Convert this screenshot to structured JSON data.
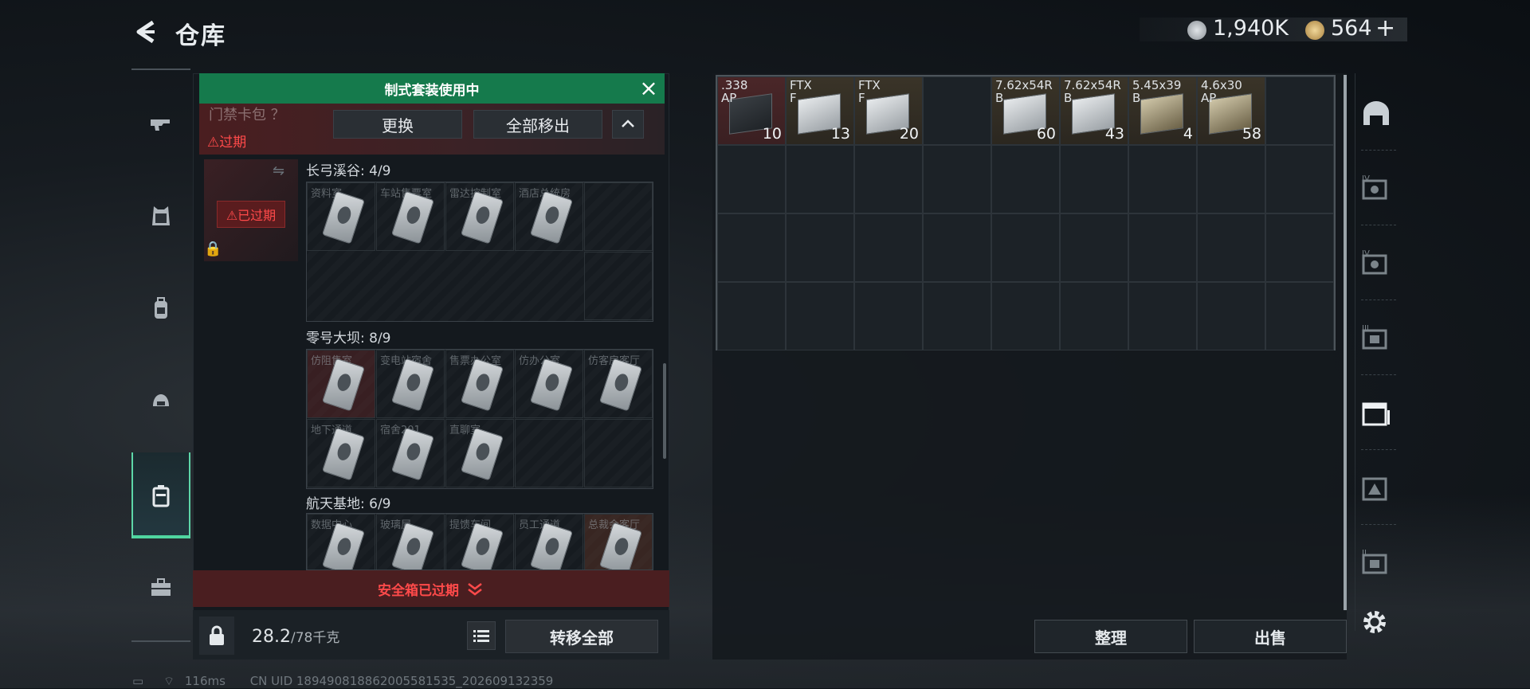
{
  "header": {
    "title": "仓库",
    "currency1": "1,940K",
    "currency2": "564",
    "add_symbol": "+"
  },
  "left_rail": {
    "items": [
      {
        "name": "rail-weapon",
        "icon": "gun-icon"
      },
      {
        "name": "rail-armor",
        "icon": "vest-icon"
      },
      {
        "name": "rail-backpack",
        "icon": "backpack-icon"
      },
      {
        "name": "rail-helmet",
        "icon": "helmet-icon"
      },
      {
        "name": "rail-keycard-case",
        "icon": "case-icon",
        "active": true
      },
      {
        "name": "rail-toolbox",
        "icon": "toolbox-icon"
      }
    ]
  },
  "left_panel": {
    "banner": "制式套装使用中",
    "package_label": "门禁卡包 ？",
    "expired_tag": "⚠过期",
    "replace_button": "更换",
    "remove_all_button": "全部移出",
    "slot_expired": "⚠已过期",
    "sections": [
      {
        "title": "长弓溪谷: 4/9",
        "cells": [
          "资料室",
          "车站售票室",
          "雷达控制室",
          "酒店总统房"
        ]
      },
      {
        "title": "零号大坝: 8/9",
        "cells": [
          "仿阻售室",
          "变电站宿舍",
          "售票办公室",
          "仿办公室",
          "仿客房客厅",
          "地下通道",
          "宿舍201",
          "直聊室"
        ]
      },
      {
        "title": "航天基地: 6/9",
        "cells": [
          "数据中心",
          "玻璃屋",
          "提馈车间",
          "员工通道",
          "总裁会客厅"
        ]
      }
    ],
    "safe_box_status": "安全箱已过期",
    "weight_current": "28.2",
    "weight_max": "/78千克",
    "transfer_all_button": "转移全部"
  },
  "stash": {
    "items": [
      {
        "label": ".338\nAP",
        "count": "10",
        "style": "red",
        "box": "dark"
      },
      {
        "label": "FTX\nF",
        "count": "13",
        "style": "tan",
        "box": "light"
      },
      {
        "label": "FTX\nF",
        "count": "20",
        "style": "tan",
        "box": "light"
      },
      {
        "label": "",
        "count": "",
        "style": "empty",
        "box": "none"
      },
      {
        "label": "7.62x54R\nB",
        "count": "60",
        "style": "tan",
        "box": "light"
      },
      {
        "label": "7.62x54R\nB",
        "count": "43",
        "style": "tan",
        "box": "light"
      },
      {
        "label": "5.45x39\nB",
        "count": "4",
        "style": "tan",
        "box": "ammo"
      },
      {
        "label": "4.6x30\nAP",
        "count": "58",
        "style": "tan",
        "box": "ammo"
      }
    ],
    "sort_button": "整理",
    "sell_button": "出售"
  },
  "right_rail": {
    "items": [
      "vehicle-icon",
      "container-iv-icon",
      "container-iv-b-icon",
      "container-iii-icon",
      "container-active-icon",
      "container-warn-icon",
      "container-ii-icon"
    ]
  },
  "status_bar": {
    "ping": "116ms",
    "uid": "CN UID 1894908188620055815​35_202609132359"
  }
}
